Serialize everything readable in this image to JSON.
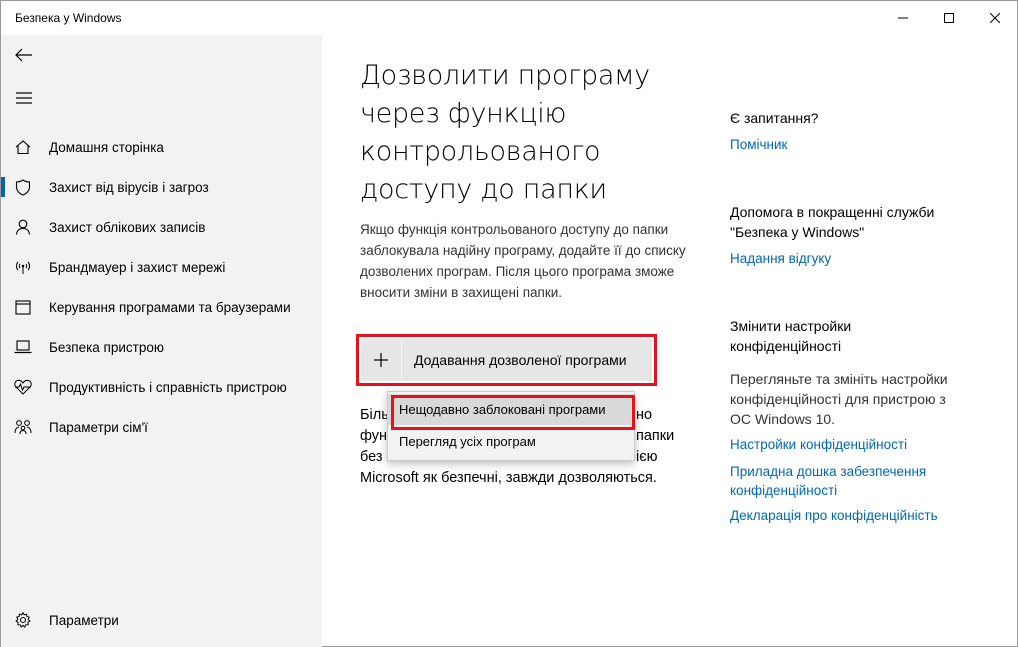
{
  "window": {
    "title": "Безпека у Windows"
  },
  "sidebar": {
    "items": [
      {
        "label": "Домашня сторінка",
        "icon": "home-icon"
      },
      {
        "label": "Захист від вірусів і загроз",
        "icon": "shield-icon",
        "active": true
      },
      {
        "label": "Захист облікових записів",
        "icon": "person-icon"
      },
      {
        "label": "Брандмауер і захист мережі",
        "icon": "wifi-antenna-icon"
      },
      {
        "label": "Керування програмами та браузерами",
        "icon": "app-window-icon"
      },
      {
        "label": "Безпека пристрою",
        "icon": "laptop-icon"
      },
      {
        "label": "Продуктивність і справність пристрою",
        "icon": "heart-pulse-icon"
      },
      {
        "label": "Параметри сім'ї",
        "icon": "family-icon"
      }
    ],
    "settings_label": "Параметри"
  },
  "main": {
    "title": "Дозволити програму через функцію контрольованого доступу до папки",
    "description": "Якщо функція контрольованого доступу до папки заблокувала надійну програму, додайте її до списку дозволених програм. Після цього програма зможе вносити зміни в захищені папки.",
    "add_button_label": "Додавання дозволеної програми",
    "note_line1": "Біль",
    "note_line1_end": "но",
    "note_line2": "фун",
    "note_line2_end": "папки",
    "note_line3": "без",
    "note_line3_end": "ією",
    "note_line4": "Microsoft як безпечні, завжди дозволяються."
  },
  "menu": {
    "items": [
      "Нещодавно заблоковані програми",
      "Перегляд усіх програм"
    ]
  },
  "right": {
    "question_heading": "Є запитання?",
    "help_link": "Помічник",
    "improve_heading": "Допомога в покращенні служби \"Безпека у Windows\"",
    "feedback_link": "Надання відгуку",
    "privacy_heading": "Змінити настройки конфіденційності",
    "privacy_text": "Перегляньте та змініть настройки конфіденційності для пристрою з ОС Windows 10.",
    "privacy_settings_link": "Настройки конфіденційності",
    "privacy_dashboard_link": "Приладна дошка забезпечення конфіденційності",
    "privacy_statement_link": "Декларація про конфіденційність"
  },
  "colors": {
    "accent": "#0063b1",
    "link": "#0067b8",
    "highlight": "#e8111b"
  }
}
